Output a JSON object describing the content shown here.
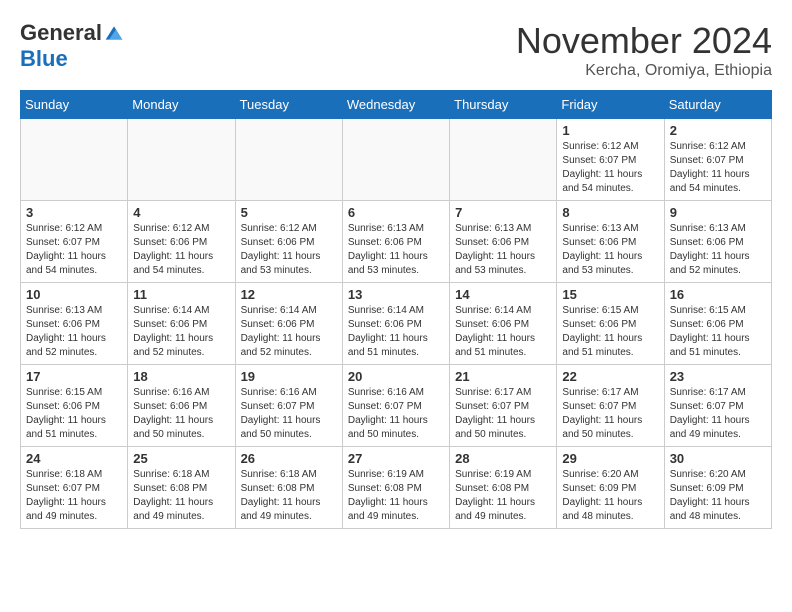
{
  "header": {
    "logo_general": "General",
    "logo_blue": "Blue",
    "month": "November 2024",
    "location": "Kercha, Oromiya, Ethiopia"
  },
  "days_of_week": [
    "Sunday",
    "Monday",
    "Tuesday",
    "Wednesday",
    "Thursday",
    "Friday",
    "Saturday"
  ],
  "weeks": [
    [
      {
        "day": "",
        "empty": true
      },
      {
        "day": "",
        "empty": true
      },
      {
        "day": "",
        "empty": true
      },
      {
        "day": "",
        "empty": true
      },
      {
        "day": "",
        "empty": true
      },
      {
        "day": "1",
        "sunrise": "6:12 AM",
        "sunset": "6:07 PM",
        "daylight": "11 hours and 54 minutes."
      },
      {
        "day": "2",
        "sunrise": "6:12 AM",
        "sunset": "6:07 PM",
        "daylight": "11 hours and 54 minutes."
      }
    ],
    [
      {
        "day": "3",
        "sunrise": "6:12 AM",
        "sunset": "6:07 PM",
        "daylight": "11 hours and 54 minutes."
      },
      {
        "day": "4",
        "sunrise": "6:12 AM",
        "sunset": "6:06 PM",
        "daylight": "11 hours and 54 minutes."
      },
      {
        "day": "5",
        "sunrise": "6:12 AM",
        "sunset": "6:06 PM",
        "daylight": "11 hours and 53 minutes."
      },
      {
        "day": "6",
        "sunrise": "6:13 AM",
        "sunset": "6:06 PM",
        "daylight": "11 hours and 53 minutes."
      },
      {
        "day": "7",
        "sunrise": "6:13 AM",
        "sunset": "6:06 PM",
        "daylight": "11 hours and 53 minutes."
      },
      {
        "day": "8",
        "sunrise": "6:13 AM",
        "sunset": "6:06 PM",
        "daylight": "11 hours and 53 minutes."
      },
      {
        "day": "9",
        "sunrise": "6:13 AM",
        "sunset": "6:06 PM",
        "daylight": "11 hours and 52 minutes."
      }
    ],
    [
      {
        "day": "10",
        "sunrise": "6:13 AM",
        "sunset": "6:06 PM",
        "daylight": "11 hours and 52 minutes."
      },
      {
        "day": "11",
        "sunrise": "6:14 AM",
        "sunset": "6:06 PM",
        "daylight": "11 hours and 52 minutes."
      },
      {
        "day": "12",
        "sunrise": "6:14 AM",
        "sunset": "6:06 PM",
        "daylight": "11 hours and 52 minutes."
      },
      {
        "day": "13",
        "sunrise": "6:14 AM",
        "sunset": "6:06 PM",
        "daylight": "11 hours and 51 minutes."
      },
      {
        "day": "14",
        "sunrise": "6:14 AM",
        "sunset": "6:06 PM",
        "daylight": "11 hours and 51 minutes."
      },
      {
        "day": "15",
        "sunrise": "6:15 AM",
        "sunset": "6:06 PM",
        "daylight": "11 hours and 51 minutes."
      },
      {
        "day": "16",
        "sunrise": "6:15 AM",
        "sunset": "6:06 PM",
        "daylight": "11 hours and 51 minutes."
      }
    ],
    [
      {
        "day": "17",
        "sunrise": "6:15 AM",
        "sunset": "6:06 PM",
        "daylight": "11 hours and 51 minutes."
      },
      {
        "day": "18",
        "sunrise": "6:16 AM",
        "sunset": "6:06 PM",
        "daylight": "11 hours and 50 minutes."
      },
      {
        "day": "19",
        "sunrise": "6:16 AM",
        "sunset": "6:07 PM",
        "daylight": "11 hours and 50 minutes."
      },
      {
        "day": "20",
        "sunrise": "6:16 AM",
        "sunset": "6:07 PM",
        "daylight": "11 hours and 50 minutes."
      },
      {
        "day": "21",
        "sunrise": "6:17 AM",
        "sunset": "6:07 PM",
        "daylight": "11 hours and 50 minutes."
      },
      {
        "day": "22",
        "sunrise": "6:17 AM",
        "sunset": "6:07 PM",
        "daylight": "11 hours and 50 minutes."
      },
      {
        "day": "23",
        "sunrise": "6:17 AM",
        "sunset": "6:07 PM",
        "daylight": "11 hours and 49 minutes."
      }
    ],
    [
      {
        "day": "24",
        "sunrise": "6:18 AM",
        "sunset": "6:07 PM",
        "daylight": "11 hours and 49 minutes."
      },
      {
        "day": "25",
        "sunrise": "6:18 AM",
        "sunset": "6:08 PM",
        "daylight": "11 hours and 49 minutes."
      },
      {
        "day": "26",
        "sunrise": "6:18 AM",
        "sunset": "6:08 PM",
        "daylight": "11 hours and 49 minutes."
      },
      {
        "day": "27",
        "sunrise": "6:19 AM",
        "sunset": "6:08 PM",
        "daylight": "11 hours and 49 minutes."
      },
      {
        "day": "28",
        "sunrise": "6:19 AM",
        "sunset": "6:08 PM",
        "daylight": "11 hours and 49 minutes."
      },
      {
        "day": "29",
        "sunrise": "6:20 AM",
        "sunset": "6:09 PM",
        "daylight": "11 hours and 48 minutes."
      },
      {
        "day": "30",
        "sunrise": "6:20 AM",
        "sunset": "6:09 PM",
        "daylight": "11 hours and 48 minutes."
      }
    ]
  ]
}
